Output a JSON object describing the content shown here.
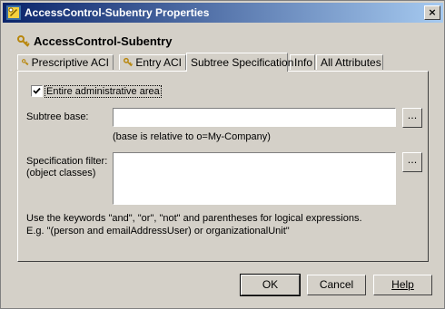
{
  "window": {
    "title": "AccessControl-Subentry Properties",
    "close_label": "×"
  },
  "header": {
    "title": "AccessControl-Subentry"
  },
  "tabs": [
    {
      "label": "Prescriptive ACI",
      "icon": "key-icon"
    },
    {
      "label": "Entry ACI",
      "icon": "key-icon"
    },
    {
      "label": "Subtree Specification",
      "active": true
    },
    {
      "label": "Info"
    },
    {
      "label": "All Attributes"
    }
  ],
  "form": {
    "entire_area_label": "Entire administrative area",
    "entire_area_checked": true,
    "subtree_base_label": "Subtree base:",
    "subtree_base_value": "",
    "subtree_base_browse": "...",
    "subtree_base_hint": "(base is relative to o=My-Company)",
    "spec_filter_label_1": "Specification filter:",
    "spec_filter_label_2": "(object classes)",
    "spec_filter_value": "",
    "spec_filter_browse": "...",
    "help_line_1": "Use the keywords \"and\", \"or\", \"not\" and parentheses for logical expressions.",
    "help_line_2": "E.g. \"(person and emailAddressUser) or organizationalUnit\""
  },
  "buttons": {
    "ok": "OK",
    "cancel": "Cancel",
    "help": "Help"
  },
  "colors": {
    "titlebar_start": "#0a246a",
    "titlebar_end": "#a6caf0",
    "dialog_bg": "#d4d0c8"
  }
}
